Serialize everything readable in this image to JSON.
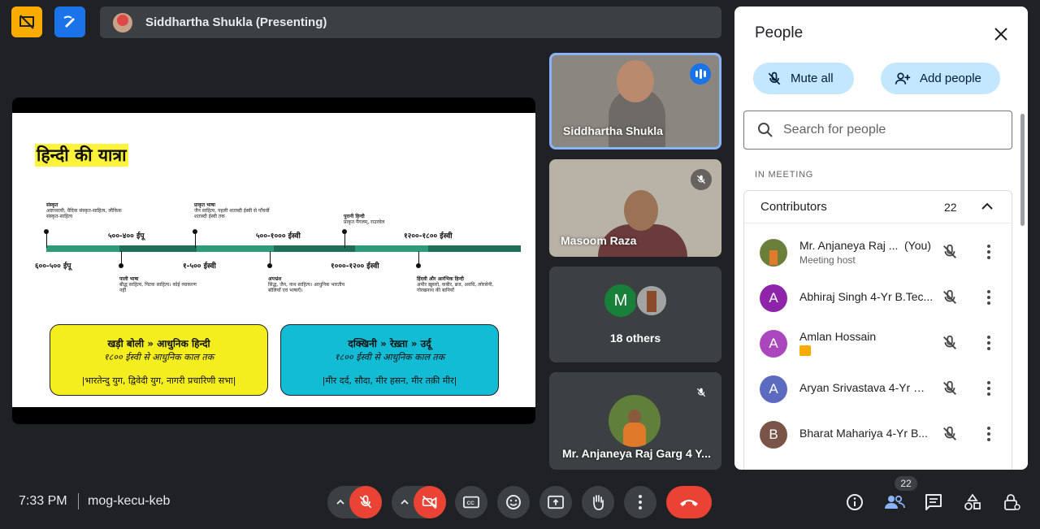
{
  "top": {
    "presenter": "Siddhartha Shukla (Presenting)"
  },
  "slide": {
    "title": "हिन्दी की यात्रा",
    "eras_top": [
      "५००-४०० ईपू",
      "५००-१००० ईस्वी",
      "१२००-१८०० ईस्वी"
    ],
    "eras_bottom": [
      "६००-५०० ईपू",
      "१-५०० ईस्वी",
      "१०००-१२०० ईस्वी"
    ],
    "labels_top": [
      {
        "head": "संस्कृत",
        "body": "अष्टाध्यायी, वैदिक संस्कृत-साहित्य, लौकिक संस्कृत-साहित्य"
      },
      {
        "head": "प्राकृत भाषा",
        "body": "जैन साहित्य, पहली शताब्दी ईस्वी से पाँचवीं शताब्दी ईस्वी तक"
      },
      {
        "head": "पुरानी हिन्दी",
        "body": "प्राकृत पैंगलम्, राउरवेल"
      }
    ],
    "labels_bottom": [
      {
        "head": "पाली भाषा",
        "body": "बौद्ध साहित्य, पिटक साहित्य। कोई व्याकरण नहीं"
      },
      {
        "head": "अपभ्रंश",
        "body": "सिद्ध, जैन, नाथ साहित्य। आधुनिक भारतीय बोलियाँ एवं भाषाएँ।"
      },
      {
        "head": "हिंदवी और आरंभिक हिन्दी",
        "body": "अमीर ख़ुसरो, कबीर, ब्रज, अवधि, लोरसेनी, गोरखनाथ की बानियाँ"
      }
    ],
    "box_left": {
      "line1": "खड़ी बोली » आधुनिक हिन्दी",
      "line2": "१८०० ईस्वी से आधुनिक काल तक",
      "line3": "|भारतेन्दु युग, द्विवेदी युग, नागरी प्रचारिणी सभा|"
    },
    "box_right": {
      "line1": "दक्खिनी » रेख़्ता » उर्दू",
      "line2": "१८०० ईस्वी से आधुनिक काल तक",
      "line3": "|मीर दर्द, सौदा, मीर हसन, मीर तक़ी मीर|"
    }
  },
  "tiles": [
    {
      "name": "Siddhartha Shukla"
    },
    {
      "name": "Masoom Raza"
    },
    {
      "name": "18 others",
      "initial": "M"
    },
    {
      "name": "Mr. Anjaneya Raj Garg 4 Y..."
    }
  ],
  "panel": {
    "title": "People",
    "mute_all": "Mute all",
    "add_people": "Add people",
    "search_placeholder": "Search for people",
    "section": "IN MEETING",
    "group_label": "Contributors",
    "group_count": "22",
    "people": [
      {
        "name": "Mr. Anjaneya Raj ...",
        "you": "(You)",
        "sub": "Meeting host",
        "initial": "",
        "color": "#6b7f3a"
      },
      {
        "name": "Abhiraj Singh 4-Yr B.Tec...",
        "initial": "A",
        "color": "#8e24aa"
      },
      {
        "name": "Amlan Hossain",
        "initial": "A",
        "color": "#ab47bc"
      },
      {
        "name": "Aryan Srivastava 4-Yr B...",
        "initial": "A",
        "color": "#5c6bc0"
      },
      {
        "name": "Bharat Mahariya 4-Yr B...",
        "initial": "B",
        "color": "#795548"
      }
    ]
  },
  "bottom": {
    "time": "7:33 PM",
    "meeting_code": "mog-kecu-keb",
    "participant_count": "22"
  }
}
